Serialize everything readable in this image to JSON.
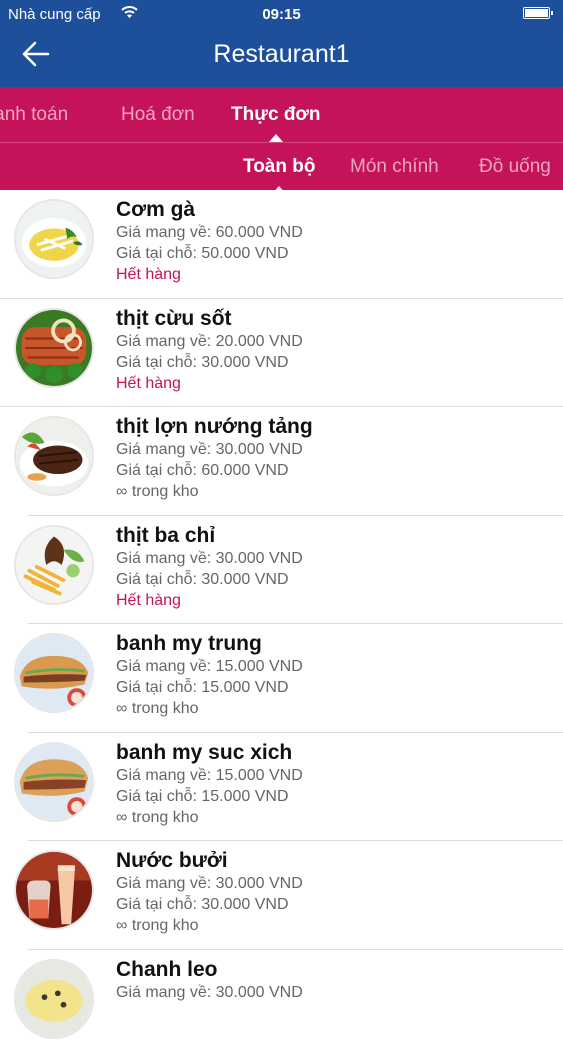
{
  "status_bar": {
    "carrier": "Nhà cung cấp",
    "time": "09:15"
  },
  "nav": {
    "title": "Restaurant1"
  },
  "main_tabs": [
    {
      "label": "Thanh toán",
      "active": false
    },
    {
      "label": "Hoá đơn",
      "active": false
    },
    {
      "label": "Thực đơn",
      "active": true
    }
  ],
  "filter_tabs": [
    {
      "label": "Toàn bộ",
      "active": true
    },
    {
      "label": "Món chính",
      "active": false
    },
    {
      "label": "Đồ uống",
      "active": false
    }
  ],
  "colors": {
    "nav_bg": "#1e4f9a",
    "tab_bg": "#c4135a",
    "out_of_stock": "#c4135a"
  },
  "menu_items": [
    {
      "name": "Cơm gà",
      "takeaway_price": "Giá mang về: 60.000 VND",
      "dinein_price": "Giá tại chỗ: 50.000 VND",
      "stock": "Hết hàng",
      "out_of_stock": true,
      "image": "chicken-rice"
    },
    {
      "name": "thịt cừu sốt",
      "takeaway_price": "Giá mang về: 20.000 VND",
      "dinein_price": "Giá tại chỗ: 30.000 VND",
      "stock": "Hết hàng",
      "out_of_stock": true,
      "image": "lamb-sauce"
    },
    {
      "name": "thịt lợn nướng tảng",
      "takeaway_price": "Giá mang về: 30.000 VND",
      "dinein_price": "Giá tại chỗ: 60.000 VND",
      "stock": "∞ trong kho",
      "out_of_stock": false,
      "image": "grilled-pork"
    },
    {
      "name": "thịt ba chỉ",
      "takeaway_price": "Giá mang về: 30.000 VND",
      "dinein_price": "Giá tại chỗ: 30.000 VND",
      "stock": "Hết hàng",
      "out_of_stock": true,
      "image": "pork-belly"
    },
    {
      "name": "banh my trung",
      "takeaway_price": "Giá mang về: 15.000 VND",
      "dinein_price": "Giá tại chỗ: 15.000 VND",
      "stock": "∞ trong kho",
      "out_of_stock": false,
      "image": "banh-mi-egg"
    },
    {
      "name": "banh my suc xich",
      "takeaway_price": "Giá mang về: 15.000 VND",
      "dinein_price": "Giá tại chỗ: 15.000 VND",
      "stock": "∞ trong kho",
      "out_of_stock": false,
      "image": "banh-mi-sausage"
    },
    {
      "name": "Nước bưởi",
      "takeaway_price": "Giá mang về: 30.000 VND",
      "dinein_price": "Giá tại chỗ: 30.000 VND",
      "stock": "∞ trong kho",
      "out_of_stock": false,
      "image": "grapefruit-juice"
    },
    {
      "name": "Chanh leo",
      "takeaway_price": "Giá mang về: 30.000 VND",
      "dinein_price": "",
      "stock": "",
      "out_of_stock": false,
      "image": "passion-fruit"
    }
  ]
}
